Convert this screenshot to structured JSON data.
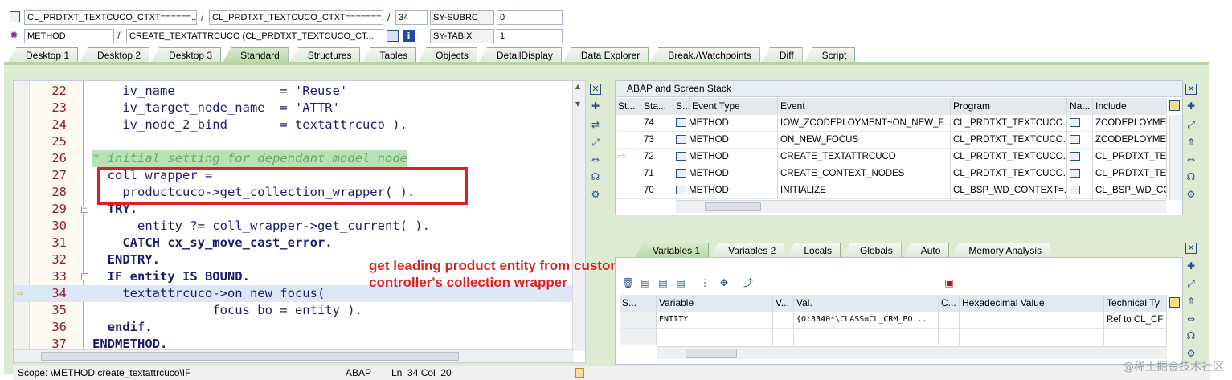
{
  "header": {
    "row1": {
      "class_field": "CL_PRDTXT_TEXTCUCO_CTXT======...",
      "include_field": "CL_PRDTXT_TEXTCUCO_CTXT=======...",
      "line": "34",
      "sysfield": "SY-SUBRC",
      "sysvalue": "0"
    },
    "row2": {
      "type_field": "METHOD",
      "method_field": "CREATE_TEXTATTRCUCO (CL_PRDTXT_TEXTCUCO_CT...",
      "sysfield": "SY-TABIX",
      "sysvalue": "1"
    }
  },
  "tabs": [
    "Desktop 1",
    "Desktop 2",
    "Desktop 3",
    "Standard",
    "Structures",
    "Tables",
    "Objects",
    "DetailDisplay",
    "Data Explorer",
    "Break./Watchpoints",
    "Diff",
    "Script"
  ],
  "active_tab": "Standard",
  "code": [
    {
      "ln": "22",
      "text": "    iv_name              = 'Reuse'"
    },
    {
      "ln": "23",
      "text": "    iv_target_node_name  = 'ATTR'"
    },
    {
      "ln": "24",
      "text": "    iv_node_2_bind       = textattrcuco )."
    },
    {
      "ln": "25",
      "text": ""
    },
    {
      "ln": "26",
      "text": "* initial setting for dependant model node"
    },
    {
      "ln": "27",
      "text": "  coll_wrapper ="
    },
    {
      "ln": "28",
      "text": "    productcuco->get_collection_wrapper( )."
    },
    {
      "ln": "29",
      "text": "  TRY."
    },
    {
      "ln": "30",
      "text": "      entity ?= coll_wrapper->get_current( )."
    },
    {
      "ln": "31",
      "text": "    CATCH cx_sy_move_cast_error."
    },
    {
      "ln": "32",
      "text": "  ENDTRY."
    },
    {
      "ln": "33",
      "text": "  IF entity IS BOUND."
    },
    {
      "ln": "34",
      "text": "    textattrcuco->on_new_focus("
    },
    {
      "ln": "35",
      "text": "                focus_bo = entity )."
    },
    {
      "ln": "36",
      "text": "  endif."
    },
    {
      "ln": "37",
      "text": "ENDMETHOD."
    }
  ],
  "annotation": [
    "get leading product entity from customer",
    "controller's collection wrapper"
  ],
  "stack": {
    "title": "ABAP and Screen Stack",
    "columns": [
      "St...",
      "Sta...",
      "S...",
      "Event Type",
      "Event",
      "Program",
      "Na...",
      "Include"
    ],
    "rows": [
      {
        "level": "74",
        "type": "METHOD",
        "event": "IOW_ZCODEPLOYMENT~ON_NEW_F...",
        "program": "CL_PRDTXT_TEXTCUCO...",
        "include": "ZCODEPLOYMEN"
      },
      {
        "level": "73",
        "type": "METHOD",
        "event": "ON_NEW_FOCUS",
        "program": "CL_PRDTXT_TEXTCUCO...",
        "include": "ZCODEPLOYMEN"
      },
      {
        "level": "72",
        "type": "METHOD",
        "event": "CREATE_TEXTATTRCUCO",
        "program": "CL_PRDTXT_TEXTCUCO...",
        "include": "CL_PRDTXT_TE>"
      },
      {
        "level": "71",
        "type": "METHOD",
        "event": "CREATE_CONTEXT_NODES",
        "program": "CL_PRDTXT_TEXTCUCO...",
        "include": "CL_PRDTXT_TE>"
      },
      {
        "level": "70",
        "type": "METHOD",
        "event": "INITIALIZE",
        "program": "CL_BSP_WD_CONTEXT=...",
        "include": "CL_BSP_WD_CO"
      }
    ]
  },
  "var_tabs": [
    "Variables 1",
    "Variables 2",
    "Locals",
    "Globals",
    "Auto",
    "Memory Analysis"
  ],
  "vars": {
    "columns": [
      "S...",
      "Variable",
      "V...",
      "Val.",
      "C...",
      "Hexadecimal Value",
      "Technical Ty"
    ],
    "rows": [
      {
        "variable": "ENTITY",
        "value": "{O:3340*\\CLASS=CL_CRM_BO...",
        "technical": "Ref to CL_CF"
      }
    ]
  },
  "status": {
    "scope": "Scope: \\METHOD create_textattrcuco\\IF",
    "lang": "ABAP",
    "pos": "Ln  34 Col  20"
  },
  "watermark": "@稀土掘金技术社区"
}
